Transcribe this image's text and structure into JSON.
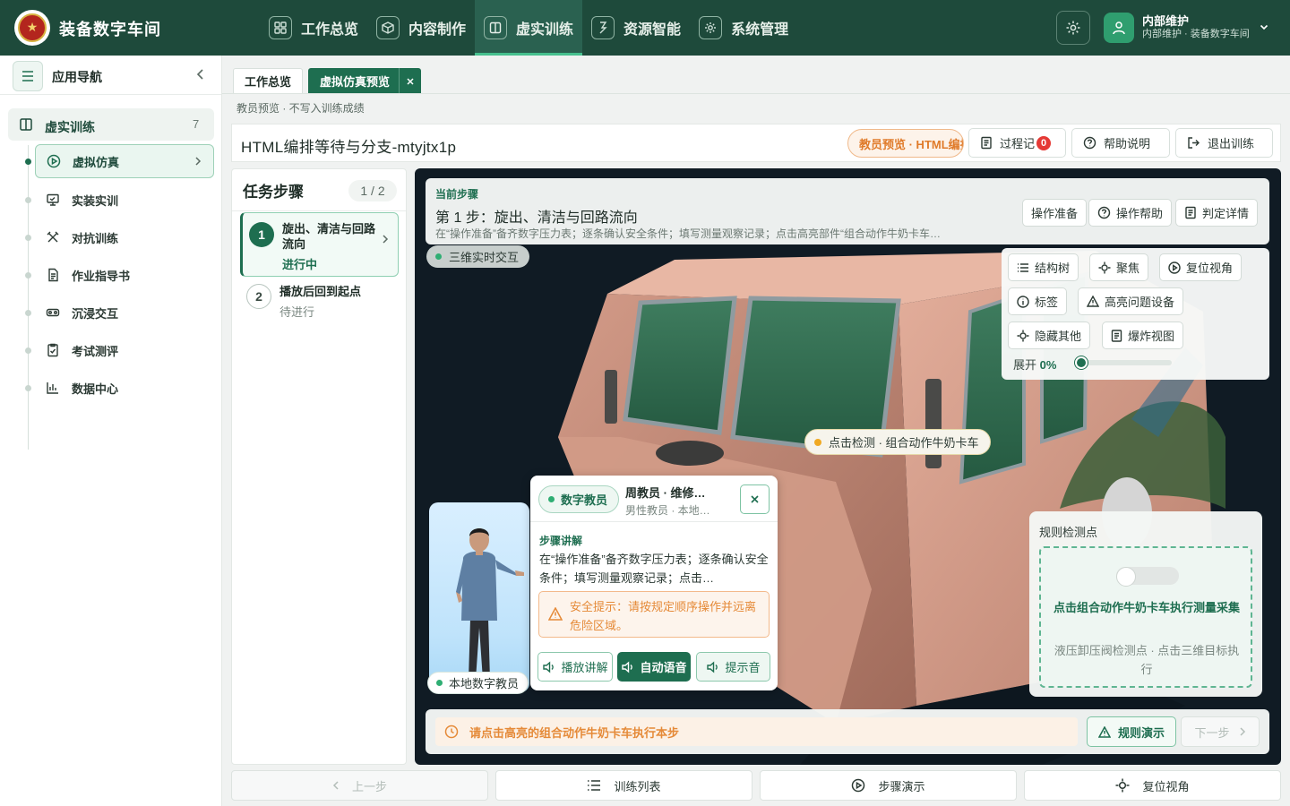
{
  "header": {
    "brand": "装备数字车间",
    "nav": [
      {
        "label": "工作总览",
        "icon": "grid-icon"
      },
      {
        "label": "内容制作",
        "icon": "cube-icon"
      },
      {
        "label": "虚实训练",
        "icon": "book-icon",
        "active": true
      },
      {
        "label": "资源智能",
        "icon": "bolt-icon"
      },
      {
        "label": "系统管理",
        "icon": "gear-icon"
      }
    ],
    "user": {
      "name": "内部维护",
      "subtitle": "内部维护 · 装备数字车间"
    }
  },
  "sidebar": {
    "title": "应用导航",
    "group": {
      "label": "虚实训练",
      "count": "7"
    },
    "items": [
      {
        "label": "虚拟仿真",
        "icon": "play-circle-icon",
        "active": true
      },
      {
        "label": "实装实训",
        "icon": "monitor-icon"
      },
      {
        "label": "对抗训练",
        "icon": "swords-icon"
      },
      {
        "label": "作业指导书",
        "icon": "document-icon"
      },
      {
        "label": "沉浸交互",
        "icon": "vr-headset-icon"
      },
      {
        "label": "考试测评",
        "icon": "exam-icon"
      },
      {
        "label": "数据中心",
        "icon": "bar-chart-icon"
      }
    ]
  },
  "tabs": [
    {
      "label": "工作总览"
    },
    {
      "label": "虚拟仿真预览",
      "active": true
    }
  ],
  "breadcrumb": "教员预览 · 不写入训练成绩",
  "titlebar": {
    "title": "HTML编排等待与分支-mtyjtx1p",
    "mode_pill": "教员预览 · HTML编排",
    "process_label": "过程记",
    "process_badge": "0",
    "help_label": "帮助说明",
    "exit_label": "退出训练"
  },
  "steps": {
    "title": "任务步骤",
    "count": "1 / 2",
    "items": [
      {
        "num": "1",
        "title": "旋出、清洁与回路流向",
        "status": "进行中"
      },
      {
        "num": "2",
        "title": "播放后回到起点",
        "status": "待进行"
      }
    ]
  },
  "current_step": {
    "label": "当前步骤",
    "title": "第 1 步：旋出、清洁与回路流向",
    "desc": "在“操作准备”备齐数字压力表；逐条确认安全条件；填写测量观察记录；点击高亮部件“组合动作牛奶卡车…",
    "buttons": [
      "操作准备",
      "操作帮助",
      "判定详情"
    ]
  },
  "scene": {
    "live_label": "三维实时交互",
    "hotspot": "点击检测 · 组合动作牛奶卡车",
    "colors": {
      "truck": "#d9a08e",
      "window": "#2e6b4f",
      "background": "#101b24"
    }
  },
  "toolbar": {
    "buttons": [
      "结构树",
      "聚焦",
      "复位视角",
      "标签",
      "高亮问题设备",
      "隐藏其他",
      "爆炸视图"
    ],
    "expand_label": "展开",
    "expand_value": "0%",
    "expand_fraction": 0
  },
  "rule_card": {
    "title": "规则检测点",
    "main": "点击组合动作牛奶卡车执行测量采集",
    "sub": "液压卸压阀检测点 · 点击三维目标执行"
  },
  "prompt": {
    "text": "请点击高亮的组合动作牛奶卡车执行本步",
    "rule_demo": "规则演示",
    "next": "下一步"
  },
  "teacher": {
    "local_label": "本地数字教员",
    "tag": "数字教员",
    "name": "周教员 · 维修…",
    "sub": "男性教员 · 本地…",
    "section_label": "步骤讲解",
    "text": "在“操作准备”备齐数字压力表；逐条确认安全条件；填写测量观察记录；点击…",
    "warning": "安全提示：请按规定顺序操作并远离危险区域。",
    "buttons": [
      "播放讲解",
      "自动语音",
      "提示音"
    ]
  },
  "bottom": {
    "prev": "上一步",
    "list": "训练列表",
    "demo": "步骤演示",
    "reset": "复位视角"
  }
}
